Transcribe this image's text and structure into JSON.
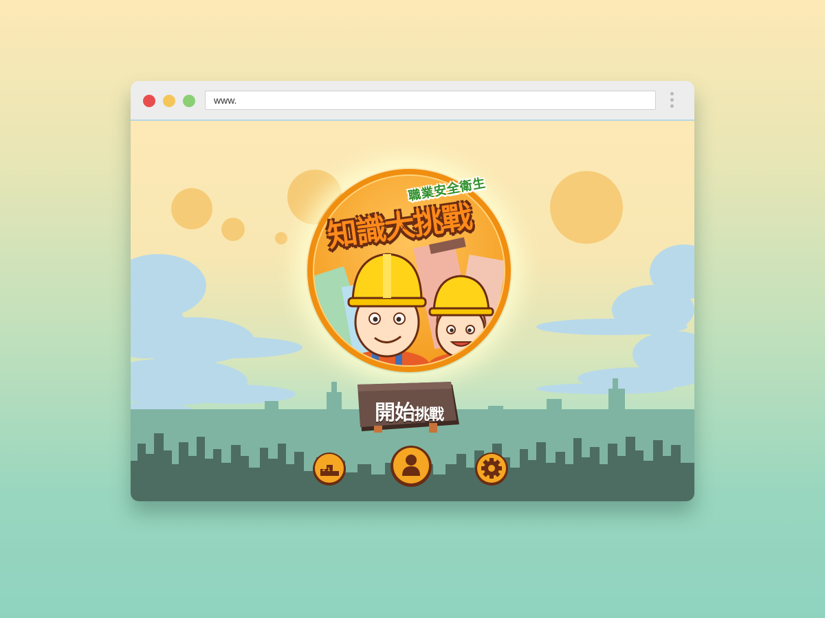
{
  "browser": {
    "url": "www.",
    "traffic_lights": {
      "close": "#e84e4e",
      "minimize": "#f4c65a",
      "zoom": "#8bcf74"
    }
  },
  "game": {
    "logo": {
      "subtitle": "職業安全衛生",
      "title": "知識大挑戰",
      "x_mark": "×"
    },
    "start_button": {
      "main": "開始",
      "small": "挑戰"
    },
    "bottom_buttons": {
      "leaderboard_digits": "213"
    }
  },
  "colors": {
    "accent_orange": "#f5a623",
    "button_brown": "#6a2c12",
    "sign_wood": "#6b5048",
    "skyline_back": "#7fb4a2",
    "skyline_front": "#4d6d62"
  }
}
